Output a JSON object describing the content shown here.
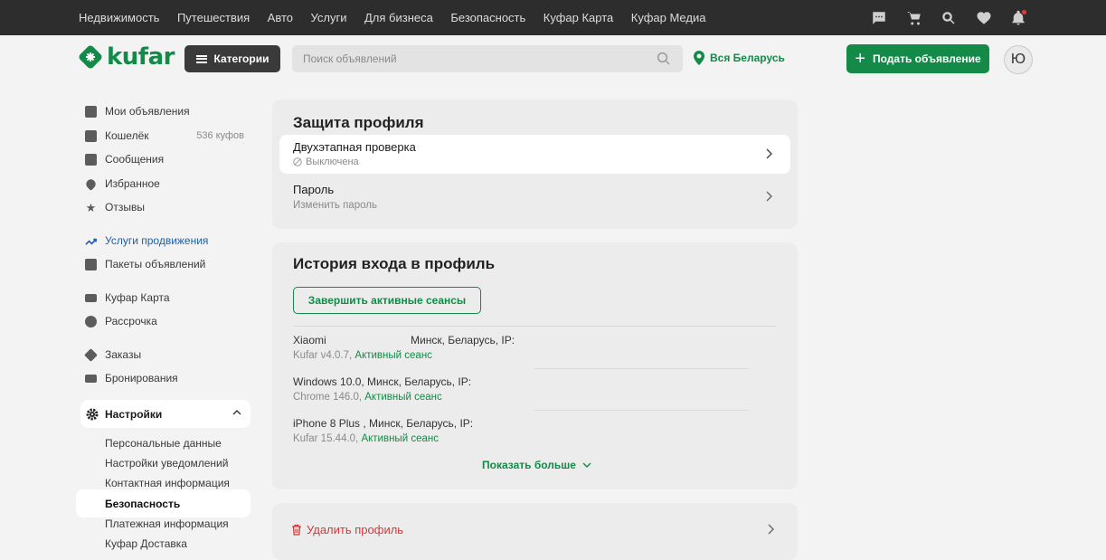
{
  "topnav": [
    "Недвижимость",
    "Путешествия",
    "Авто",
    "Услуги",
    "Для бизнеса",
    "Безопасность",
    "Куфар Карта",
    "Куфар Медиа"
  ],
  "header": {
    "logo_text": "kufar",
    "categories_label": "Категории",
    "search_placeholder": "Поиск объявлений",
    "region": "Вся Беларусь",
    "post_label": "Подать объявление",
    "avatar_letter": "Ю"
  },
  "sidebar": {
    "my_ads": "Мои объявления",
    "wallet": "Кошелёк",
    "wallet_balance": "536 куфов",
    "messages": "Сообщения",
    "favorites": "Избранное",
    "reviews": "Отзывы",
    "promo_services": "Услуги продвижения",
    "ad_packages": "Пакеты объявлений",
    "kufar_card": "Куфар Карта",
    "installments": "Рассрочка",
    "orders": "Заказы",
    "bookings": "Бронирования",
    "settings": "Настройки",
    "sub": [
      "Персональные данные",
      "Настройки уведомлений",
      "Контактная информация",
      "Безопасность",
      "Платежная информация",
      "Куфар Доставка"
    ]
  },
  "security": {
    "title": "Защита профиля",
    "twofa_title": "Двухэтапная проверка",
    "twofa_status": "Выключена",
    "password_title": "Пароль",
    "password_sub": "Изменить пароль"
  },
  "history": {
    "title": "История входа в профиль",
    "end_sessions": "Завершить активные сеансы",
    "sessions": [
      {
        "line1": "Xiaomi                            Минск, Беларусь, IP:",
        "client": "Kufar v4.0.7, ",
        "status": "Активный сеанс"
      },
      {
        "line1": "Windows 10.0, Минск, Беларусь, IP:",
        "client": "Chrome 146.0, ",
        "status": "Активный сеанс"
      },
      {
        "line1": "iPhone 8 Plus , Минск, Беларусь, IP:",
        "client": "Kufar 15.44.0, ",
        "status": "Активный сеанс"
      }
    ],
    "show_more": "Показать больше"
  },
  "delete_profile": "Удалить профиль",
  "colors": {
    "brand_green": "#138a47",
    "danger": "#d23a3a",
    "topbar": "#2d2d2d"
  }
}
